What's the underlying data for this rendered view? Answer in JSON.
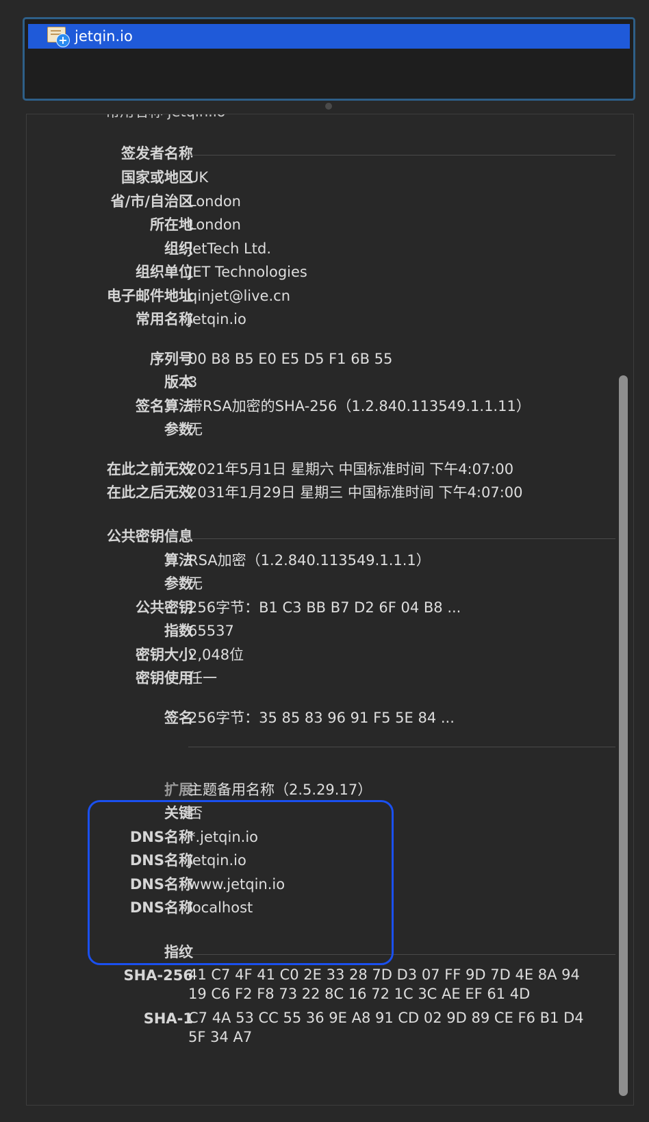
{
  "list": {
    "item": "jetqin.io"
  },
  "clipped_row": "常用名称   jetqin.io",
  "issuer": {
    "heading": "签发者名称",
    "rows": [
      {
        "label": "国家或地区",
        "value": "UK"
      },
      {
        "label": "省/市/自治区",
        "value": "London"
      },
      {
        "label": "所在地",
        "value": "London"
      },
      {
        "label": "组织",
        "value": "JetTech Ltd."
      },
      {
        "label": "组织单位",
        "value": "JET Technologies"
      },
      {
        "label": "电子邮件地址",
        "value": "qinjet@live.cn"
      },
      {
        "label": "常用名称",
        "value": "jetqin.io"
      }
    ]
  },
  "cert": {
    "rows": [
      {
        "label": "序列号",
        "value": "00 B8 B5 E0 E5 D5 F1 6B 55"
      },
      {
        "label": "版本",
        "value": "3"
      },
      {
        "label": "签名算法",
        "value": "带RSA加密的SHA-256（1.2.840.113549.1.1.11）"
      },
      {
        "label": "参数",
        "value": "无"
      }
    ]
  },
  "validity": {
    "rows": [
      {
        "label": "在此之前无效",
        "value": "2021年5月1日 星期六 中国标准时间 下午4:07:00"
      },
      {
        "label": "在此之后无效",
        "value": "2031年1月29日 星期三 中国标准时间 下午4:07:00"
      }
    ]
  },
  "pubkey": {
    "heading": "公共密钥信息",
    "rows": [
      {
        "label": "算法",
        "value": "RSA加密（1.2.840.113549.1.1.1）"
      },
      {
        "label": "参数",
        "value": "无"
      },
      {
        "label": "公共密钥",
        "value": "256字节：B1 C3 BB B7 D2 6F 04 B8 ..."
      },
      {
        "label": "指数",
        "value": "65537"
      },
      {
        "label": "密钥大小",
        "value": "2,048位"
      },
      {
        "label": "密钥使用",
        "value": "任一"
      }
    ]
  },
  "signature": {
    "label": "签名",
    "value": "256字节：35 85 83 96 91 F5 5E 84 ..."
  },
  "extension": {
    "rows": [
      {
        "label": "扩展",
        "value": "主题备用名称（2.5.29.17）"
      },
      {
        "label": "关键",
        "value": "否"
      },
      {
        "label": "DNS名称",
        "value": "*.jetqin.io"
      },
      {
        "label": "DNS名称",
        "value": "jetqin.io"
      },
      {
        "label": "DNS名称",
        "value": "www.jetqin.io"
      },
      {
        "label": "DNS名称",
        "value": "localhost"
      }
    ]
  },
  "fingerprints": {
    "heading": "指纹",
    "sha256": {
      "label": "SHA-256",
      "value": "41 C7 4F 41 C0 2E 33 28 7D D3 07 FF 9D 7D 4E 8A 94 19 C6 F2 F8 73 22 8C 16 72 1C 3C AE EF 61 4D"
    },
    "sha1": {
      "label": "SHA-1",
      "value": "C7 4A 53 CC 55 36 9E A8 91 CD 02 9D 89 CE F6 B1 D4 5F 34 A7"
    }
  }
}
